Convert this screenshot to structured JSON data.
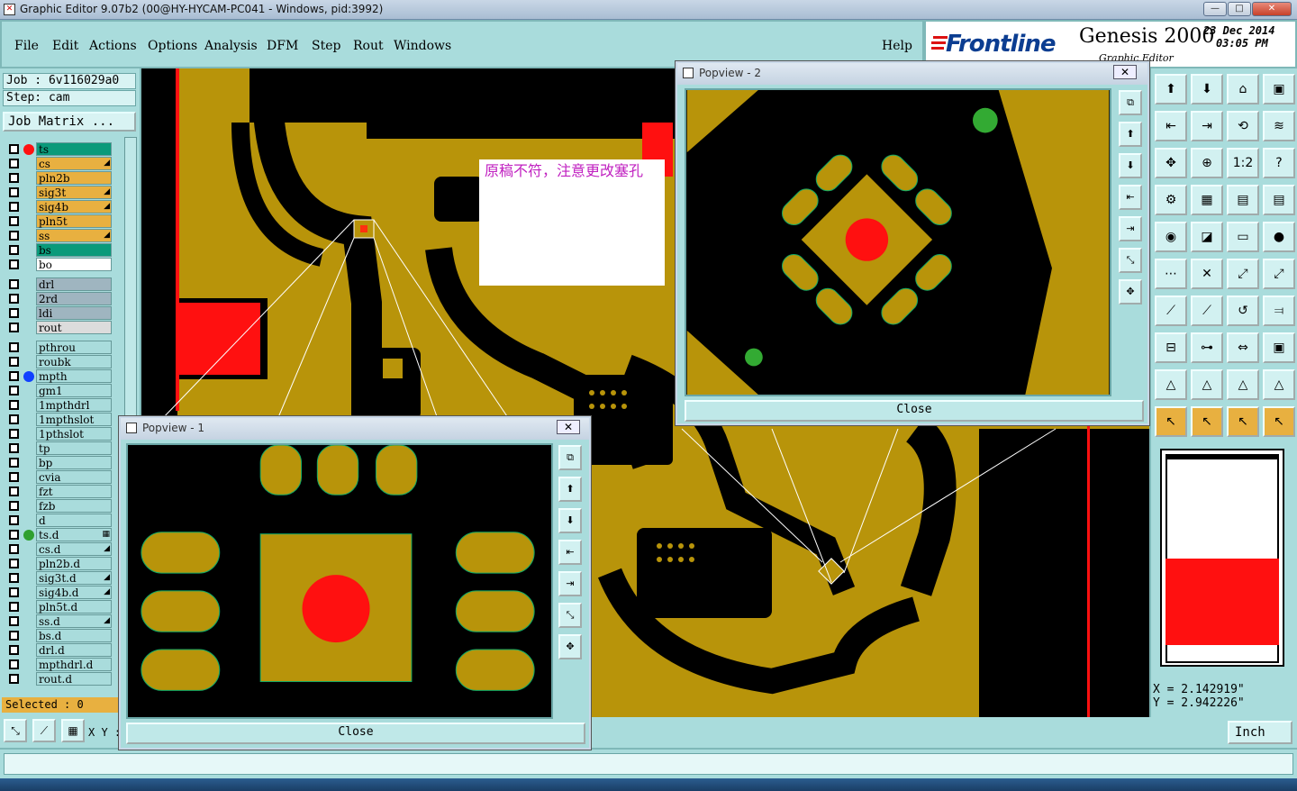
{
  "window": {
    "title": "Graphic Editor 9.07b2 (00@HY-HYCAM-PC041 - Windows, pid:3992)",
    "min": "—",
    "max": "□",
    "close": "✕"
  },
  "menu": {
    "file": "File",
    "edit": "Edit",
    "actions": "Actions",
    "options": "Options",
    "analysis": "Analysis",
    "dfm": "DFM",
    "step": "Step",
    "rout": "Rout",
    "windows": "Windows",
    "help": "Help"
  },
  "brand": {
    "logo": "Frontline",
    "product": "Genesis 2000",
    "subtitle": "Graphic Editor",
    "date": "23 Dec 2014",
    "time": "03:05 PM"
  },
  "job": {
    "label": "Job : 6v116029a0",
    "step": "Step: cam",
    "matrix": "Job Matrix ..."
  },
  "layers": [
    {
      "name": "ts",
      "color": "#0a9a7a",
      "dot": "#ff1010"
    },
    {
      "name": "cs",
      "color": "#e8b040",
      "edit": "◢"
    },
    {
      "name": "pln2b",
      "color": "#e8b040"
    },
    {
      "name": "sig3t",
      "color": "#e8b040",
      "edit": "◢"
    },
    {
      "name": "sig4b",
      "color": "#e8b040",
      "edit": "◢"
    },
    {
      "name": "pln5t",
      "color": "#e8b040"
    },
    {
      "name": "ss",
      "color": "#e8b040",
      "edit": "◢"
    },
    {
      "name": "bs",
      "color": "#0a9a7a"
    },
    {
      "name": "bo",
      "color": "#ffffff"
    },
    {
      "name": "drl",
      "color": "#9fb5c0"
    },
    {
      "name": "2rd",
      "color": "#9fb5c0"
    },
    {
      "name": "ldi",
      "color": "#9fb5c0"
    },
    {
      "name": "rout",
      "color": "#dcdcdc"
    },
    {
      "name": "pthrou",
      "color": "#a9dcdc"
    },
    {
      "name": "roubk",
      "color": "#a9dcdc"
    },
    {
      "name": "mpth",
      "color": "#a9dcdc",
      "dot": "#1040ff"
    },
    {
      "name": "gm1",
      "color": "#a9dcdc"
    },
    {
      "name": "1mpthdrl",
      "color": "#a9dcdc"
    },
    {
      "name": "1mpthslot",
      "color": "#a9dcdc"
    },
    {
      "name": "1pthslot",
      "color": "#a9dcdc"
    },
    {
      "name": "tp",
      "color": "#a9dcdc"
    },
    {
      "name": "bp",
      "color": "#a9dcdc"
    },
    {
      "name": "cvia",
      "color": "#a9dcdc"
    },
    {
      "name": "fzt",
      "color": "#a9dcdc"
    },
    {
      "name": "fzb",
      "color": "#a9dcdc"
    },
    {
      "name": "d",
      "color": "#a9dcdc"
    },
    {
      "name": "ts.d",
      "color": "#a9dcdc",
      "dot": "#30a030",
      "edit": "▦"
    },
    {
      "name": "cs.d",
      "color": "#a9dcdc",
      "edit": "◢"
    },
    {
      "name": "pln2b.d",
      "color": "#a9dcdc"
    },
    {
      "name": "sig3t.d",
      "color": "#a9dcdc",
      "edit": "◢"
    },
    {
      "name": "sig4b.d",
      "color": "#a9dcdc",
      "edit": "◢"
    },
    {
      "name": "pln5t.d",
      "color": "#a9dcdc"
    },
    {
      "name": "ss.d",
      "color": "#a9dcdc",
      "edit": "◢"
    },
    {
      "name": "bs.d",
      "color": "#a9dcdc"
    },
    {
      "name": "drl.d",
      "color": "#a9dcdc"
    },
    {
      "name": "mpthdrl.d",
      "color": "#a9dcdc"
    },
    {
      "name": "rout.d",
      "color": "#a9dcdc"
    }
  ],
  "selected": "Selected : 0",
  "note": "原稿不符，注意更改塞孔",
  "popup1": {
    "title": "Popview - 1",
    "close_label": "Close",
    "x": "✕"
  },
  "popup2": {
    "title": "Popview - 2",
    "close_label": "Close",
    "x": "✕"
  },
  "coords": {
    "x": "X = 2.142919\"",
    "y": "Y = 2.942226\""
  },
  "bottom": {
    "xy_label": "X Y :",
    "unit": "Inch"
  },
  "toolbar_rows": [
    [
      "⬆",
      "⬇",
      "⌂",
      "▣"
    ],
    [
      "⇤",
      "⇥",
      "⟲",
      "≋"
    ],
    [
      "✥",
      "⊕",
      "1:2",
      "?"
    ],
    [
      "⚙",
      "▦",
      "▤",
      "▤"
    ],
    [
      "◉",
      "◪",
      "▭",
      "●"
    ],
    [
      "⋯",
      "✕",
      "⤢",
      "⤢"
    ],
    [
      "⟋",
      "⟋",
      "↺",
      "⫤"
    ],
    [
      "⊟",
      "⊶",
      "⇔",
      "▣"
    ],
    [
      "△",
      "△",
      "△",
      "△"
    ],
    [
      "↖",
      "↖",
      "↖",
      "↖"
    ]
  ],
  "colors": {
    "copper": "#b8940a",
    "board": "#000000",
    "panel": "#a9dcdc",
    "accent": "#e8b040",
    "pad": "#ff1010"
  }
}
